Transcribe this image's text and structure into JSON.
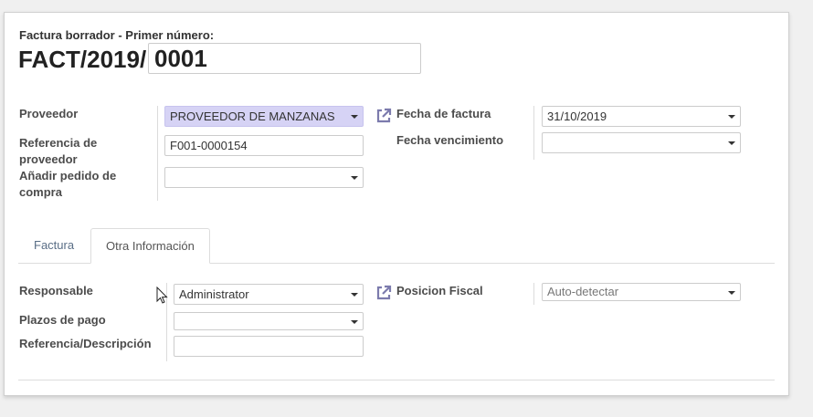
{
  "header": {
    "subtitle": "Factura borrador - Primer número:",
    "prefix": "FACT/2019/",
    "number": "0001"
  },
  "top_left": {
    "proveedor_label": "Proveedor",
    "proveedor_value": "PROVEEDOR DE MANZANAS",
    "referencia_label_1": "Referencia de",
    "referencia_label_2": "proveedor",
    "referencia_value": "F001-0000154",
    "pedido_label_1": "Añadir pedido de",
    "pedido_label_2": "compra",
    "pedido_value": ""
  },
  "top_right": {
    "fecha_factura_label": "Fecha de factura",
    "fecha_factura_value": "31/10/2019",
    "fecha_venc_label": "Fecha vencimiento",
    "fecha_venc_value": ""
  },
  "tabs": [
    {
      "label": "Factura",
      "active": false
    },
    {
      "label": "Otra Información",
      "active": true
    }
  ],
  "other_info": {
    "responsable_label": "Responsable",
    "responsable_value": "Administrator",
    "plazos_label": "Plazos de pago",
    "plazos_value": "",
    "referencia_desc_label": "Referencia/Descripción",
    "referencia_desc_value": "",
    "posicion_label": "Posicion Fiscal",
    "posicion_value": "Auto-detectar"
  },
  "colors": {
    "highlight": "#d6d3f5",
    "tab_link": "#5a6e86",
    "ext_icon": "#7c7bad"
  },
  "icons": {
    "external_link": "external-link-icon",
    "dropdown": "caret-down-icon",
    "cursor": "mouse-pointer-icon"
  }
}
